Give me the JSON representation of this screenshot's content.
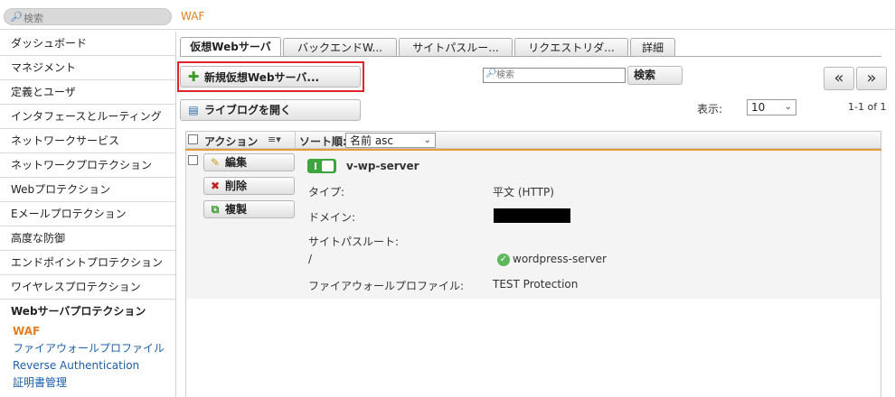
{
  "top": {
    "search_placeholder": "検索",
    "breadcrumb": "WAF"
  },
  "sidebar": {
    "items": [
      "ダッシュボード",
      "マネジメント",
      "定義とユーザ",
      "インタフェースとルーティング",
      "ネットワークサービス",
      "ネットワークプロテクション",
      "Webプロテクション",
      "Eメールプロテクション",
      "高度な防御",
      "エンドポイントプロテクション",
      "ワイヤレスプロテクション"
    ],
    "active_section": "Webサーバプロテクション",
    "sub_items": [
      "WAF",
      "ファイアウォールプロファイル",
      "Reverse Authentication",
      "証明書管理"
    ]
  },
  "tabs": [
    "仮想Webサーバ",
    "バックエンドW...",
    "サイトパスルー...",
    "リクエストリダ...",
    "詳細"
  ],
  "toolbar": {
    "new_button": "新規仮想Webサーバ...",
    "livelog_button": "ライブログを開く",
    "search_placeholder": "検索",
    "search_button": "検索",
    "prev_label": "«",
    "next_label": "»",
    "display_label": "表示:",
    "page_size": "10",
    "range_text": "1-1 of 1"
  },
  "list": {
    "action_header": "アクション",
    "sort_label": "ソート順:",
    "sort_value": "名前 asc",
    "row": {
      "edit": "編集",
      "delete": "削除",
      "clone": "複製",
      "name": "v-wp-server",
      "type_label": "タイプ:",
      "type_value": "平文 (HTTP)",
      "domain_label": "ドメイン:",
      "sitepath_label": "サイトパスルート:",
      "sitepath_path": "/",
      "sitepath_server": "wordpress-server",
      "firewall_label": "ファイアウォールプロファイル:",
      "firewall_value": "TEST Protection"
    }
  },
  "colors": {
    "accent": "#e57e21",
    "link": "#1c5fa8",
    "enabled": "#3fa53f",
    "highlight_border": "#e0242a"
  }
}
